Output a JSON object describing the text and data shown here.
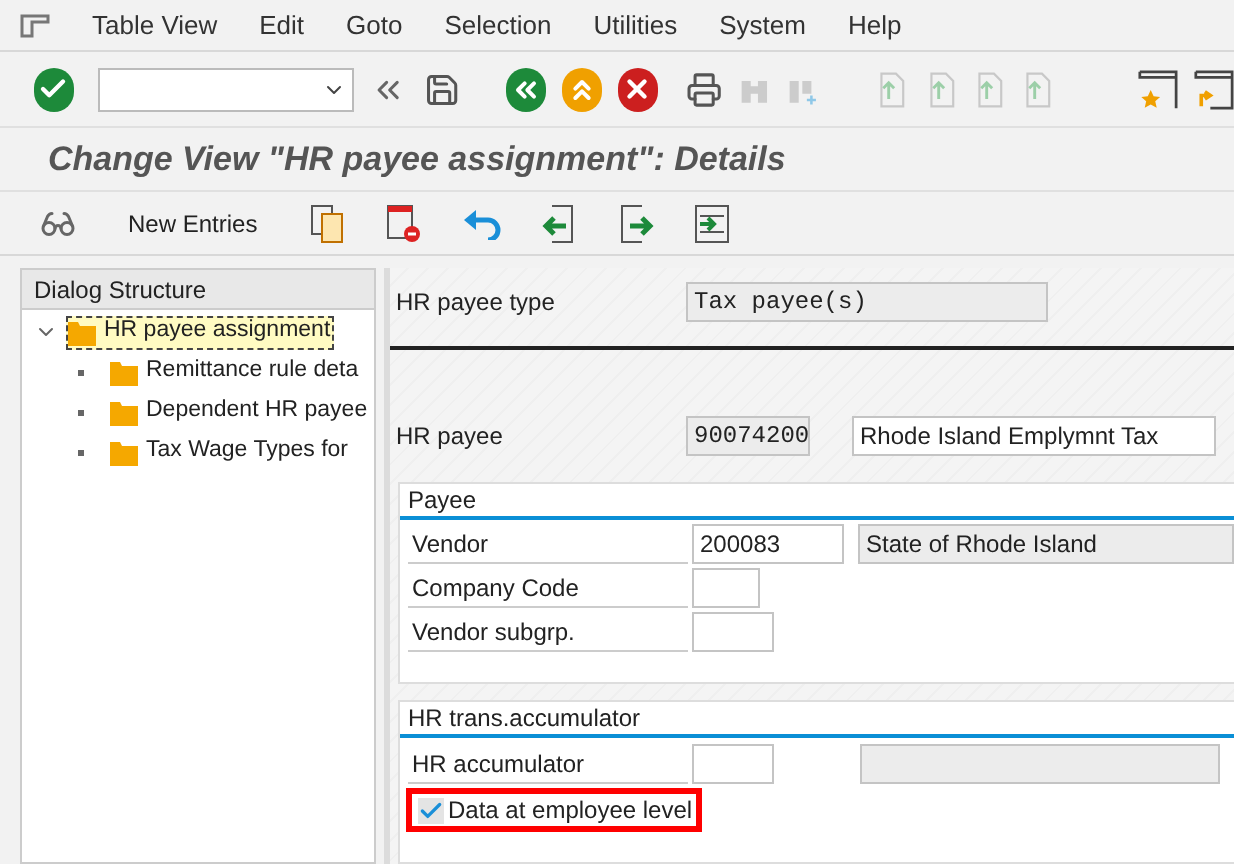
{
  "menu": [
    {
      "label": "Table View"
    },
    {
      "label": "Edit"
    },
    {
      "label": "Goto"
    },
    {
      "label": "Selection"
    },
    {
      "label": "Utilities"
    },
    {
      "label": "System"
    },
    {
      "label": "Help"
    }
  ],
  "title": "Change View \"HR payee assignment\": Details",
  "app_toolbar": {
    "new_entries": "New Entries"
  },
  "dialog_structure": {
    "heading": "Dialog Structure",
    "items": [
      {
        "label": "HR payee assignment",
        "selected": true,
        "expanded": true,
        "children": [
          {
            "label": "Remittance rule deta",
            "selected": false
          },
          {
            "label": "Dependent HR payee",
            "selected": false
          },
          {
            "label": "Tax Wage Types for",
            "selected": false
          }
        ]
      }
    ]
  },
  "payee_type": {
    "label": "HR payee type",
    "value": "Tax payee(s)"
  },
  "hr_payee": {
    "label": "HR payee",
    "value": "90074200",
    "name": "Rhode Island Emplymnt Tax"
  },
  "payee_group": {
    "title": "Payee",
    "fields": [
      {
        "label": "Vendor",
        "value": "200083",
        "description": "State of Rhode Island"
      },
      {
        "label": "Company Code"
      },
      {
        "label": "Vendor subgrp."
      }
    ]
  },
  "accumulator_group": {
    "title": "HR trans.accumulator",
    "fields": [
      {
        "label": "HR accumulator"
      }
    ],
    "checkbox": {
      "label": "Data at employee level",
      "checked": true,
      "highlighted": true
    }
  }
}
